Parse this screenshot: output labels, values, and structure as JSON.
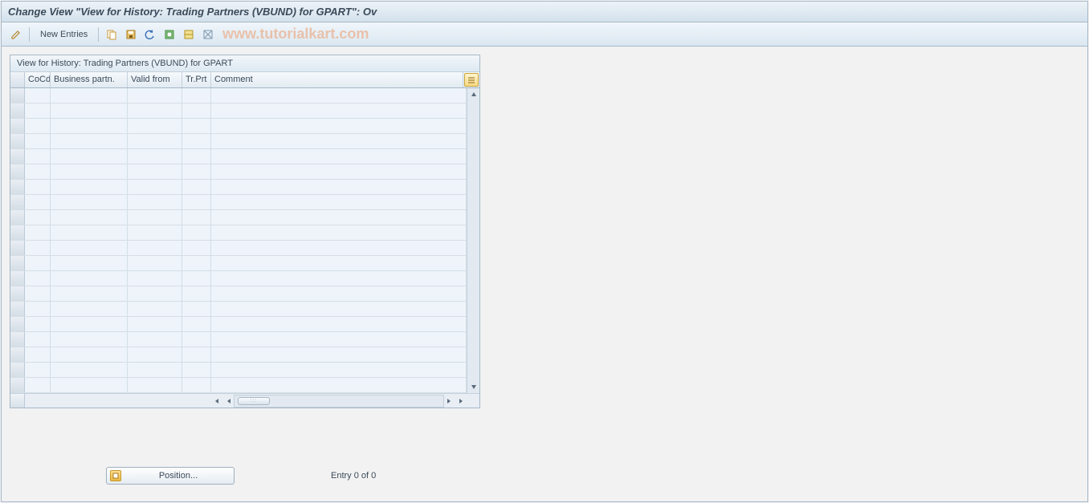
{
  "titlebar": {
    "title": "Change View \"View for History: Trading Partners (VBUND) for GPART\": Ov"
  },
  "toolbar": {
    "new_entries_label": "New Entries",
    "icons": {
      "change": "change-icon",
      "copy": "copy-icon",
      "save": "save-icon",
      "undo": "undo-icon",
      "select_all": "select-all-icon",
      "select_block": "select-block-icon",
      "deselect": "deselect-icon"
    },
    "watermark": "www.tutorialkart.com"
  },
  "grid": {
    "title": "View for History: Trading Partners (VBUND) for GPART",
    "columns": {
      "cocd": "CoCd",
      "bp": "Business partn.",
      "valid_from": "Valid from",
      "trprt": "Tr.Prt",
      "comment": "Comment"
    },
    "rows": [
      {},
      {},
      {},
      {},
      {},
      {},
      {},
      {},
      {},
      {},
      {},
      {},
      {},
      {},
      {},
      {},
      {},
      {},
      {},
      {}
    ]
  },
  "footer": {
    "position_label": "Position...",
    "entry_text": "Entry 0 of 0"
  }
}
